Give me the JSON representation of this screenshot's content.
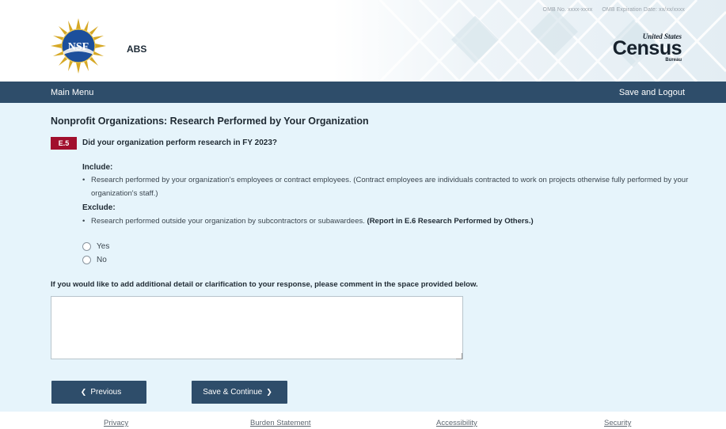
{
  "header": {
    "omb_number": "OMB No. xxxx-xxxx",
    "omb_expiration": "OMB Expiration Date: xx/xx/xxxx",
    "nsf_logo_text": "NSF",
    "app_name": "ABS",
    "census_logo": {
      "line1": "United States",
      "word": "Census",
      "line3": "Bureau"
    }
  },
  "navbar": {
    "main_menu": "Main Menu",
    "save_logout": "Save and Logout",
    "color": "#2e4d6a"
  },
  "main": {
    "title": "Nonprofit Organizations: Research Performed by Your Organization",
    "question": {
      "number": "E.5",
      "text": "Did your organization perform research in FY 2023?",
      "badge_color": "#a10f2d"
    },
    "include": {
      "label": "Include:",
      "items": [
        "Research performed by your organization's employees or contract employees. (Contract employees are individuals contracted to work on projects otherwise fully performed by your organization's staff.)"
      ]
    },
    "exclude": {
      "label": "Exclude:",
      "items": [
        {
          "text": "Research performed outside your organization by subcontractors or subawardees.",
          "note": "(Report in E.6 Research Performed by Others.)"
        }
      ]
    },
    "options": [
      "Yes",
      "No"
    ],
    "comment_label": "If you would like to add additional detail or clarification to your response, please comment in the space provided below.",
    "comment_value": "",
    "buttons": {
      "previous": "Previous",
      "save_continue": "Save & Continue"
    },
    "background_color": "#e6f4fb"
  },
  "footer": {
    "links": [
      "Privacy",
      "Burden Statement",
      "Accessibility",
      "Security"
    ]
  }
}
